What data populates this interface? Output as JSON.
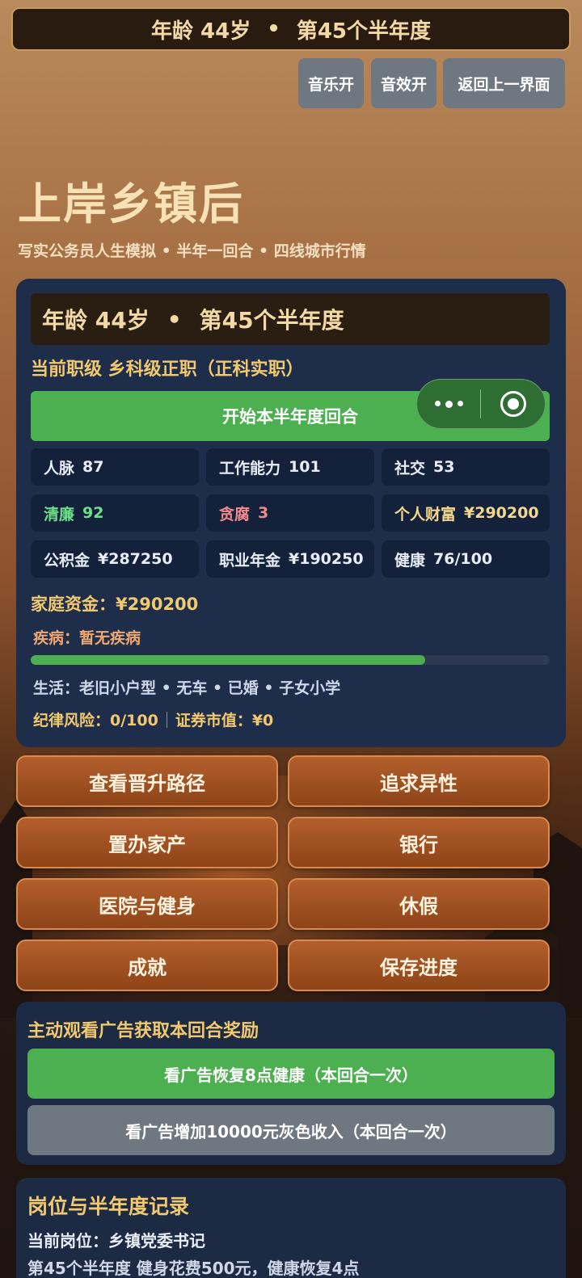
{
  "top_banner": {
    "age": "年龄  44岁",
    "dot": "•",
    "period": "第45个半年度"
  },
  "controls": {
    "music": "音乐开",
    "sound": "音效开",
    "back": "返回上一界面"
  },
  "hero": {
    "title": "上岸乡镇后",
    "subtitle": "写实公务员人生模拟 • 半年一回合 • 四线城市行情"
  },
  "status": {
    "age": "年龄  44岁",
    "dot": "•",
    "period": "第45个半年度",
    "rank": "当前职级  乡科级正职（正科实职）",
    "start_button": "开始本半年度回合",
    "capsule": {
      "more_icon": "more-dots-icon",
      "target_icon": "target-circle-icon"
    },
    "stats": [
      {
        "label": "人脉",
        "value": "87"
      },
      {
        "label": "工作能力",
        "value": "101"
      },
      {
        "label": "社交",
        "value": "53"
      },
      {
        "label": "清廉",
        "value": "92"
      },
      {
        "label": "贪腐",
        "value": "3"
      },
      {
        "label": "个人财富",
        "value": "¥290200"
      },
      {
        "label": "公积金",
        "value": "¥287250"
      },
      {
        "label": "职业年金",
        "value": "¥190250"
      },
      {
        "label": "健康",
        "value": "76/100"
      }
    ],
    "family_funds": "家庭资金：¥290200",
    "disease": "疾病：暂无疾病",
    "health_progress": 0.76,
    "life": "生活：老旧小户型 • 无车 • 已婚 • 子女小学",
    "discipline_risk": "纪律风险：0/100",
    "securities": "证券市值：¥0",
    "colors": {
      "clean": "#6ee08a",
      "corrupt": "#f08a8a",
      "accent": "#f2c96e",
      "progress": "#4caf50"
    }
  },
  "menu": [
    "查看晋升路径",
    "追求异性",
    "置办家产",
    "银行",
    "医院与健身",
    "休假",
    "成就",
    "保存进度"
  ],
  "ads": {
    "title": "主动观看广告获取本回合奖励",
    "health_button": "看广告恢复8点健康（本回合一次）",
    "income_button": "看广告增加10000元灰色收入（本回合一次）"
  },
  "log": {
    "title": "岗位与半年度记录",
    "current_post": "当前岗位：乡镇党委书记",
    "entry": "第45个半年度  健身花费500元，健康恢复4点"
  }
}
